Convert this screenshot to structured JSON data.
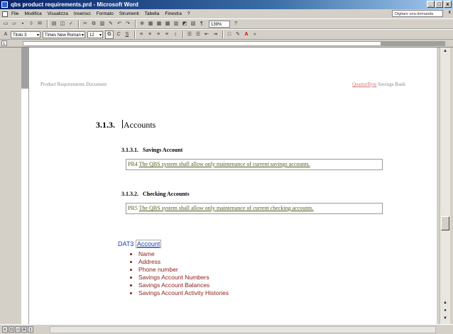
{
  "window": {
    "title": "qbs product requirements.prd - Microsoft Word",
    "buttons": [
      "_",
      "□",
      "x"
    ]
  },
  "menu": {
    "items": [
      "File",
      "Modifica",
      "Visualizza",
      "Inserisci",
      "Formato",
      "Strumenti",
      "Tabella",
      "Finestra",
      "?"
    ],
    "help_placeholder": "Digitare una domanda",
    "close": "x"
  },
  "toolbar": {
    "zoom": "139%",
    "style": "Titolo 3",
    "font": "Times New Roman",
    "size": "12",
    "bold": "G",
    "italic": "C",
    "underline": "S"
  },
  "document": {
    "header_left": "Product Requirements Document",
    "header_right_underlined": "QuarterByte",
    "header_right_rest": "Savings Bank",
    "heading3_num": "3.1.3.",
    "heading3_title": "Accounts",
    "sections": [
      {
        "num": "3.1.3.1.",
        "title": "Savings Account",
        "req_id": "PR4",
        "req_text": "The QBS system shall allow only maintenance of current savings accounts."
      },
      {
        "num": "3.1.3.2.",
        "title": "Checking Accounts",
        "req_id": "PR5",
        "req_text": "The QBS system shall allow only maintenance of current checking accounts."
      }
    ],
    "data_id": "DAT3",
    "data_entity": "Account",
    "attributes": [
      "Name",
      "Address",
      "Phone number",
      "Savings Account Numbers",
      "Savings Account Balances",
      "Savings Account Activity Histories"
    ]
  }
}
